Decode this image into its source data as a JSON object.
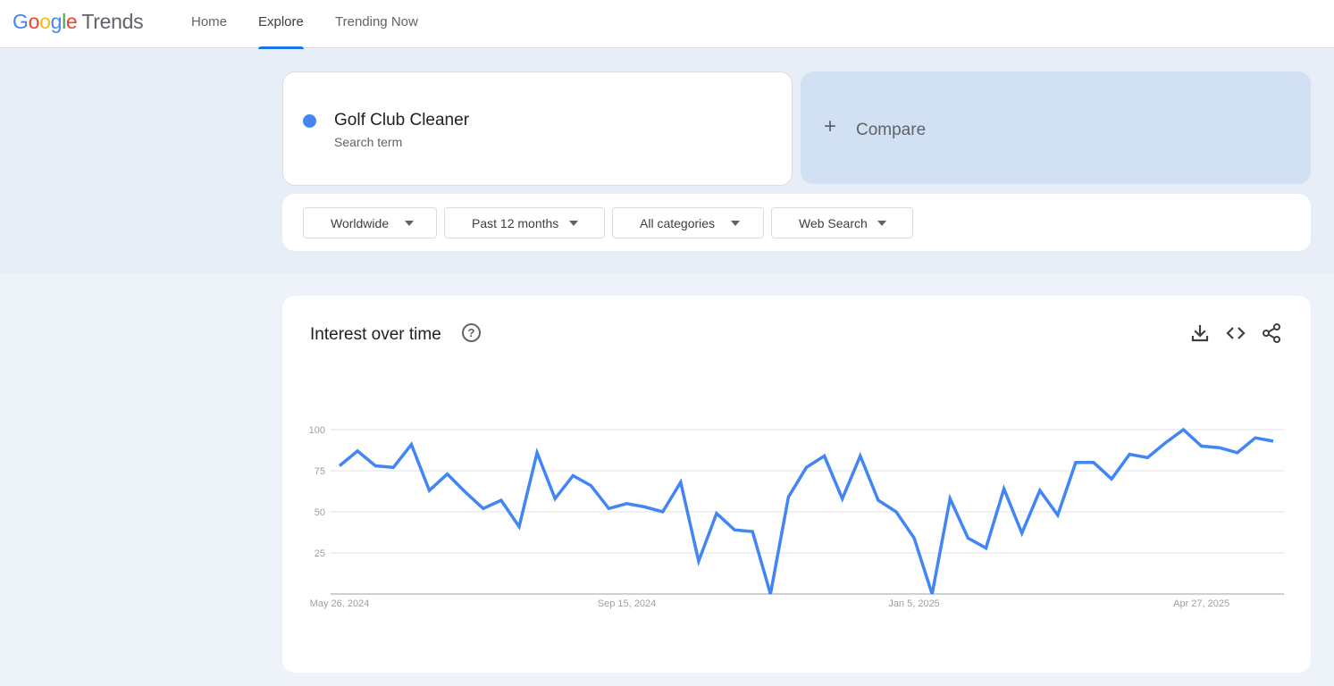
{
  "logo": {
    "g1": "G",
    "g2": "o",
    "g3": "o",
    "g4": "g",
    "g5": "l",
    "g6": "e",
    "product": "Trends"
  },
  "nav": {
    "home": "Home",
    "explore": "Explore",
    "trending": "Trending Now"
  },
  "search": {
    "term": "Golf Club Cleaner",
    "term_type": "Search term",
    "term_color": "#4285f4",
    "compare_label": "Compare"
  },
  "filters": {
    "region": "Worldwide",
    "time": "Past 12 months",
    "category": "All categories",
    "property": "Web Search"
  },
  "chart_section": {
    "title": "Interest over time",
    "icons": [
      "help-icon",
      "download-icon",
      "embed-code-icon",
      "share-icon"
    ]
  },
  "chart_data": {
    "type": "line",
    "title": "Interest over time",
    "ylim": [
      0,
      100
    ],
    "y_ticks": [
      "25",
      "50",
      "75",
      "100"
    ],
    "x_tick_labels": [
      "May 26, 2024",
      "Sep 15, 2024",
      "Jan 5, 2025",
      "Apr 27, 2025"
    ],
    "grid": true,
    "series": [
      {
        "color": "#4285f4",
        "values": [
          78,
          87,
          78,
          77,
          91,
          63,
          73,
          62,
          52,
          57,
          41,
          86,
          58,
          72,
          66,
          52,
          55,
          53,
          50,
          68,
          20,
          49,
          39,
          38,
          0,
          59,
          77,
          84,
          58,
          84,
          57,
          50,
          34,
          0,
          58,
          34,
          28,
          64,
          37,
          63,
          48,
          80,
          80,
          70,
          85,
          83,
          92,
          100,
          90,
          89,
          86,
          95,
          93
        ]
      }
    ]
  }
}
